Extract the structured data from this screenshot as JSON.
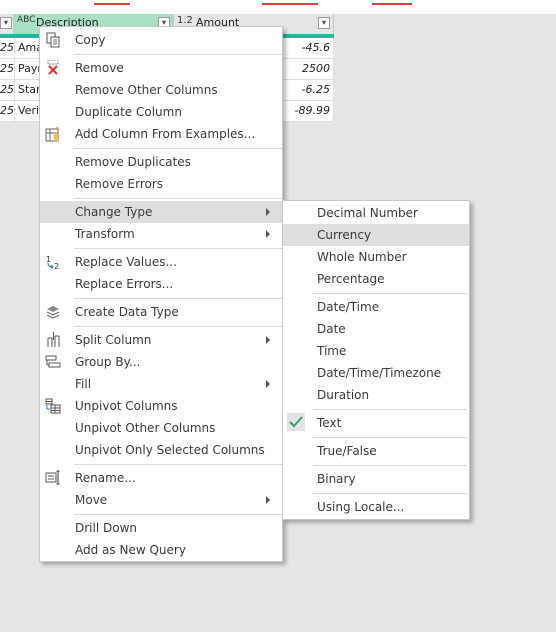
{
  "grid": {
    "columns": [
      {
        "type_badge": "",
        "label": ""
      },
      {
        "type_badge": "ABC",
        "label": "Description"
      },
      {
        "type_badge": "1.2",
        "label": "Amount"
      }
    ],
    "rows": [
      {
        "c0": "25",
        "c1": "Ama",
        "c2": "-45.6"
      },
      {
        "c0": "25",
        "c1": "Payr",
        "c2": "2500"
      },
      {
        "c0": "25",
        "c1": "Starl",
        "c2": "-6.25"
      },
      {
        "c0": "25",
        "c1": "Veriz",
        "c2": "-89.99"
      }
    ]
  },
  "context_menu": {
    "items": [
      {
        "label": "Copy",
        "icon": "copy-icon"
      },
      {
        "label": "Remove",
        "icon": "remove-icon"
      },
      {
        "label": "Remove Other Columns"
      },
      {
        "label": "Duplicate Column"
      },
      {
        "label": "Add Column From Examples...",
        "icon": "add-column-examples-icon"
      },
      {
        "label": "Remove Duplicates"
      },
      {
        "label": "Remove Errors"
      },
      {
        "label": "Change Type",
        "submenu": true,
        "highlighted": true
      },
      {
        "label": "Transform",
        "submenu": true
      },
      {
        "label": "Replace Values...",
        "icon": "replace-values-icon"
      },
      {
        "label": "Replace Errors..."
      },
      {
        "label": "Create Data Type",
        "icon": "data-type-icon"
      },
      {
        "label": "Split Column",
        "submenu": true,
        "icon": "split-column-icon"
      },
      {
        "label": "Group By...",
        "icon": "group-by-icon"
      },
      {
        "label": "Fill",
        "submenu": true
      },
      {
        "label": "Unpivot Columns",
        "icon": "unpivot-icon"
      },
      {
        "label": "Unpivot Other Columns"
      },
      {
        "label": "Unpivot Only Selected Columns"
      },
      {
        "label": "Rename...",
        "icon": "rename-icon"
      },
      {
        "label": "Move",
        "submenu": true
      },
      {
        "label": "Drill Down"
      },
      {
        "label": "Add as New Query"
      }
    ]
  },
  "type_submenu": {
    "items": [
      {
        "label": "Decimal Number"
      },
      {
        "label": "Currency",
        "highlighted": true
      },
      {
        "label": "Whole Number"
      },
      {
        "label": "Percentage"
      },
      {
        "label": "Date/Time"
      },
      {
        "label": "Date"
      },
      {
        "label": "Time"
      },
      {
        "label": "Date/Time/Timezone"
      },
      {
        "label": "Duration"
      },
      {
        "label": "Text",
        "checked": true
      },
      {
        "label": "True/False"
      },
      {
        "label": "Binary"
      },
      {
        "label": "Using Locale..."
      }
    ]
  },
  "colors": {
    "selected_header": "#a9e0c4",
    "teal_bar": "#20b8a0",
    "menu_highlight": "#dedede",
    "check_green": "#3aa56a",
    "top_annotation_red": "#d94040"
  }
}
